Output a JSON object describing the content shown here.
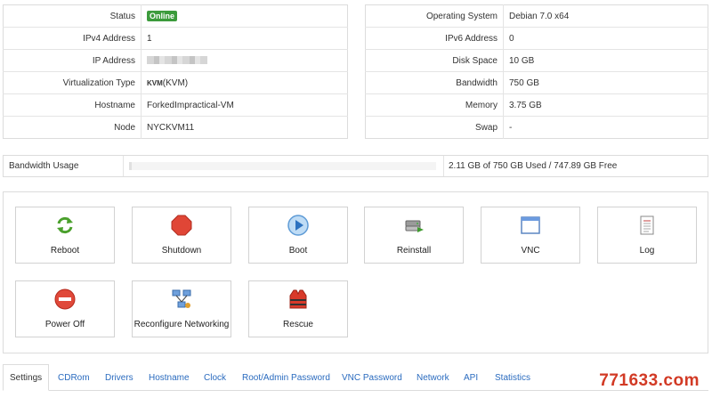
{
  "left_info": {
    "status_label": "Status",
    "status_value": "Online",
    "ipv4_label": "IPv4 Address",
    "ipv4_value": "1",
    "ip_label": "IP Address",
    "virt_label": "Virtualization Type",
    "virt_strong": "KVM",
    "virt_value": "(KVM)",
    "hostname_label": "Hostname",
    "hostname_value": "ForkedImpractical-VM",
    "node_label": "Node",
    "node_value": "NYCKVM11"
  },
  "right_info": {
    "os_label": "Operating System",
    "os_value": "Debian 7.0 x64",
    "ipv6_label": "IPv6 Address",
    "ipv6_value": "0",
    "disk_label": "Disk Space",
    "disk_value": "10 GB",
    "bandwidth_label": "Bandwidth",
    "bandwidth_value": "750 GB",
    "memory_label": "Memory",
    "memory_value": "3.75 GB",
    "swap_label": "Swap",
    "swap_value": "-"
  },
  "bandwidth_usage": {
    "label": "Bandwidth Usage",
    "used_fraction": 0.0028,
    "text": "2.11 GB of 750 GB Used / 747.89 GB Free"
  },
  "actions": {
    "reboot": "Reboot",
    "shutdown": "Shutdown",
    "boot": "Boot",
    "reinstall": "Reinstall",
    "vnc": "VNC",
    "log": "Log",
    "power_off": "Power Off",
    "reconfigure": "Reconfigure Networking",
    "rescue": "Rescue"
  },
  "tabs": {
    "settings": "Settings",
    "cdrom": "CDRom",
    "drivers": "Drivers",
    "hostname": "Hostname",
    "clock": "Clock",
    "root_password": "Root/Admin Password",
    "vnc_password": "VNC Password",
    "network": "Network",
    "api": "API",
    "statistics": "Statistics"
  },
  "watermark": "771633.com",
  "colors": {
    "online": "#3c9b3c",
    "link": "#2a6bbf",
    "watermark": "#d23a25"
  },
  "icons": [
    "reboot-icon",
    "stop-icon",
    "play-icon",
    "server-icon",
    "window-icon",
    "log-icon",
    "no-entry-icon",
    "network-icon",
    "lifejacket-icon"
  ]
}
